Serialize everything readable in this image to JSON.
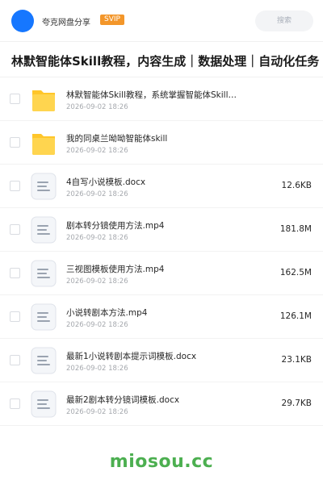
{
  "header": {
    "site_name": "夸克网盘分享",
    "badge": "SVIP",
    "search_placeholder": "搜索",
    "avatar_color": "#1677ff"
  },
  "page_title": "林默智能体Skill教程，内容生成｜数据处理｜自动化任务",
  "files": [
    {
      "name": "林默智能体Skill教程，系统掌握智能体Skill…",
      "date": "2026-09-02 18:26",
      "size": "",
      "type": "folder-icon"
    },
    {
      "name": "我的同桌兰呦呦智能体skill",
      "date": "2026-09-02 18:26",
      "size": "",
      "type": "folder-icon"
    },
    {
      "name": "4自写小说模板.docx",
      "date": "2026-09-02 18:26",
      "size": "12.6KB",
      "type": "document-icon"
    },
    {
      "name": "剧本转分镜使用方法.mp4",
      "date": "2026-09-02 18:26",
      "size": "181.8M",
      "type": "document-icon"
    },
    {
      "name": "三视图模板使用方法.mp4",
      "date": "2026-09-02 18:26",
      "size": "162.5M",
      "type": "document-icon"
    },
    {
      "name": "小说转剧本方法.mp4",
      "date": "2026-09-02 18:26",
      "size": "126.1M",
      "type": "document-icon"
    },
    {
      "name": "最新1小说转剧本提示词模板.docx",
      "date": "2026-09-02 18:26",
      "size": "23.1KB",
      "type": "document-icon"
    },
    {
      "name": "最新2剧本转分镜词模板.docx",
      "date": "2026-09-02 18:26",
      "size": "29.7KB",
      "type": "document-icon"
    }
  ],
  "watermark": "miosou.cc",
  "colors": {
    "folder": "#ffcc33",
    "svip": "#f3962a",
    "watermark": "#4caf50"
  }
}
